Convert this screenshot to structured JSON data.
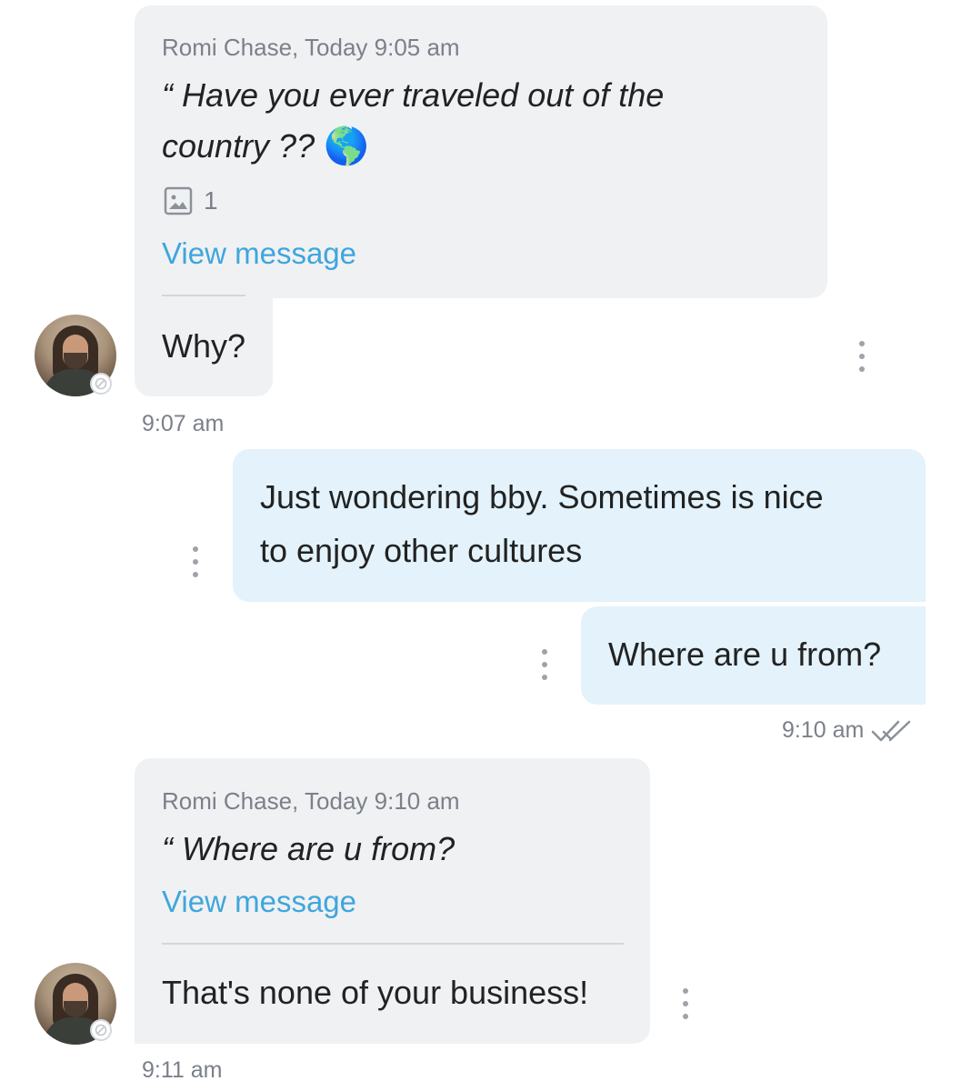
{
  "messages": {
    "reply1": {
      "meta": "Romi Chase, Today 9:05 am",
      "quote_line1": "“ Have you ever traveled out of the",
      "quote_line2": "country ??",
      "globe_emoji": "🌎",
      "attachment_count": "1",
      "view_link": "View message",
      "body": "Why?",
      "time": "9:07 am"
    },
    "out1": {
      "line1": "Just wondering bby. Sometimes is nice",
      "line2": "to enjoy other cultures"
    },
    "out2": {
      "body": "Where are u from?",
      "time": "9:10 am",
      "read_status_icon": "double-check-icon"
    },
    "reply2": {
      "meta": "Romi Chase, Today 9:10 am",
      "quote": "“ Where are u from?",
      "view_link": "View message",
      "body": "That's none of your business!",
      "time": "9:11 am"
    }
  },
  "colors": {
    "incoming_bubble": "#f0f1f3",
    "outgoing_bubble": "#e3f2fb",
    "link": "#3ea6dc",
    "meta_text": "#7b8089"
  }
}
